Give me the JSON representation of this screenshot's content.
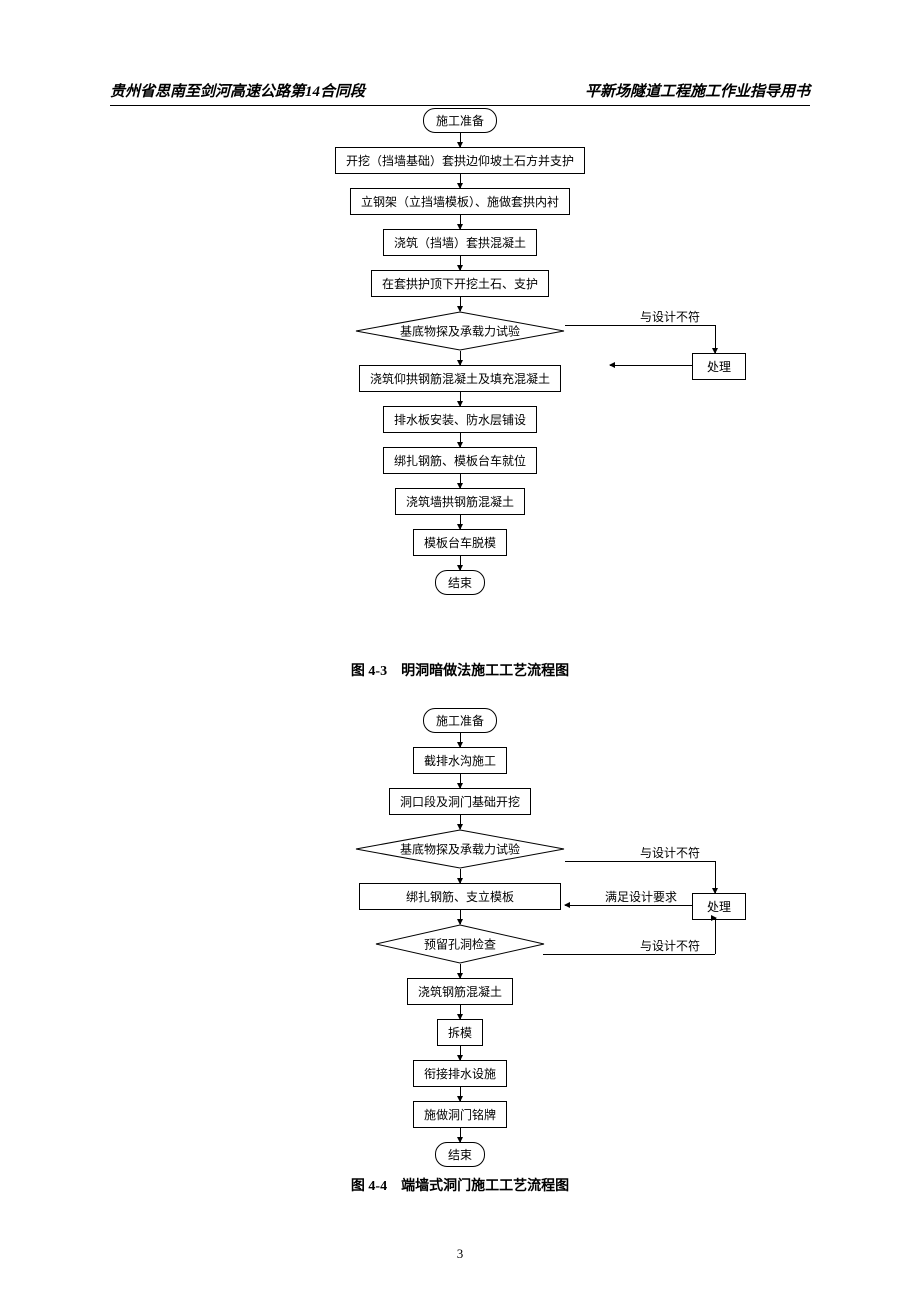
{
  "header": {
    "left": "贵州省思南至剑河高速公路第14合同段",
    "right": "平新场隧道工程施工作业指导用书"
  },
  "flow1": {
    "start": "施工准备",
    "steps": [
      "开挖（挡墙基础）套拱边仰坡土石方并支护",
      "立钢架（立挡墙模板）、施做套拱内衬",
      "浇筑（挡墙）套拱混凝土",
      "在套拱护顶下开挖土石、支护"
    ],
    "decision": "基底物探及承载力试验",
    "branch_label": "与设计不符",
    "branch_box": "处理",
    "steps2": [
      "浇筑仰拱钢筋混凝土及填充混凝土",
      "排水板安装、防水层铺设",
      "绑扎钢筋、模板台车就位",
      "浇筑墙拱钢筋混凝土",
      "模板台车脱模"
    ],
    "end": "结束",
    "caption": "图 4-3　明洞暗做法施工工艺流程图"
  },
  "flow2": {
    "start": "施工准备",
    "steps": [
      "截排水沟施工",
      "洞口段及洞门基础开挖"
    ],
    "decision1": "基底物探及承载力试验",
    "branch1_label": "与设计不符",
    "return_label": "满足设计要求",
    "branch_box": "处理",
    "mid": "绑扎钢筋、支立模板",
    "decision2": "预留孔洞检查",
    "branch2_label": "与设计不符",
    "steps2": [
      "浇筑钢筋混凝土",
      "拆模",
      "衔接排水设施",
      "施做洞门铭牌"
    ],
    "end": "结束",
    "caption": "图 4-4　端墙式洞门施工工艺流程图"
  },
  "page_number": "3"
}
